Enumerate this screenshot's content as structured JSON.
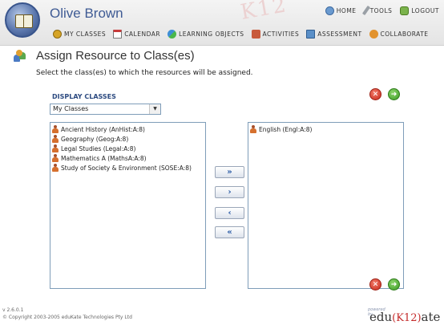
{
  "header": {
    "username": "Olive Brown",
    "watermark": "K12",
    "topnav": [
      {
        "label": "HOME",
        "icon": "home-icon"
      },
      {
        "label": "TOOLS",
        "icon": "tools-icon"
      },
      {
        "label": "LOGOUT",
        "icon": "logout-icon"
      }
    ],
    "mainnav": [
      {
        "label": "MY CLASSES",
        "icon": "classes-icon"
      },
      {
        "label": "CALENDAR",
        "icon": "calendar-icon"
      },
      {
        "label": "LEARNING OBJECTS",
        "icon": "learning-objects-icon"
      },
      {
        "label": "ACTIVITIES",
        "icon": "activities-icon"
      },
      {
        "label": "ASSESSMENT",
        "icon": "assessment-icon"
      },
      {
        "label": "COLLABORATE",
        "icon": "collaborate-icon"
      }
    ]
  },
  "page": {
    "title": "Assign Resource to Class(es)",
    "instructions": "Select the class(es) to which the resources will be assigned.",
    "display_label": "DISPLAY CLASSES",
    "select_value": "My Classes"
  },
  "available_classes": [
    "Ancient History (AnHist:A:8)",
    "Geography (Geog:A:8)",
    "Legal Studies (Legal:A:8)",
    "Mathematics A (MathsA:A:8)",
    "Study of Society & Environment (SOSE:A:8)"
  ],
  "selected_classes": [
    "English (Engl:A:8)"
  ],
  "buttons": {
    "add_all": "»",
    "add": "›",
    "remove": "‹",
    "remove_all": "«",
    "cancel": "✕",
    "go": "➜"
  },
  "footer": {
    "version": "v 2.6.0.1",
    "copyright": "© Copyright 2003-2005 eduKate Technologies Pty Ltd",
    "logo_powered": "powered by",
    "logo_prefix": "edu",
    "logo_k12": "(K12)",
    "logo_suffix": "ate"
  }
}
